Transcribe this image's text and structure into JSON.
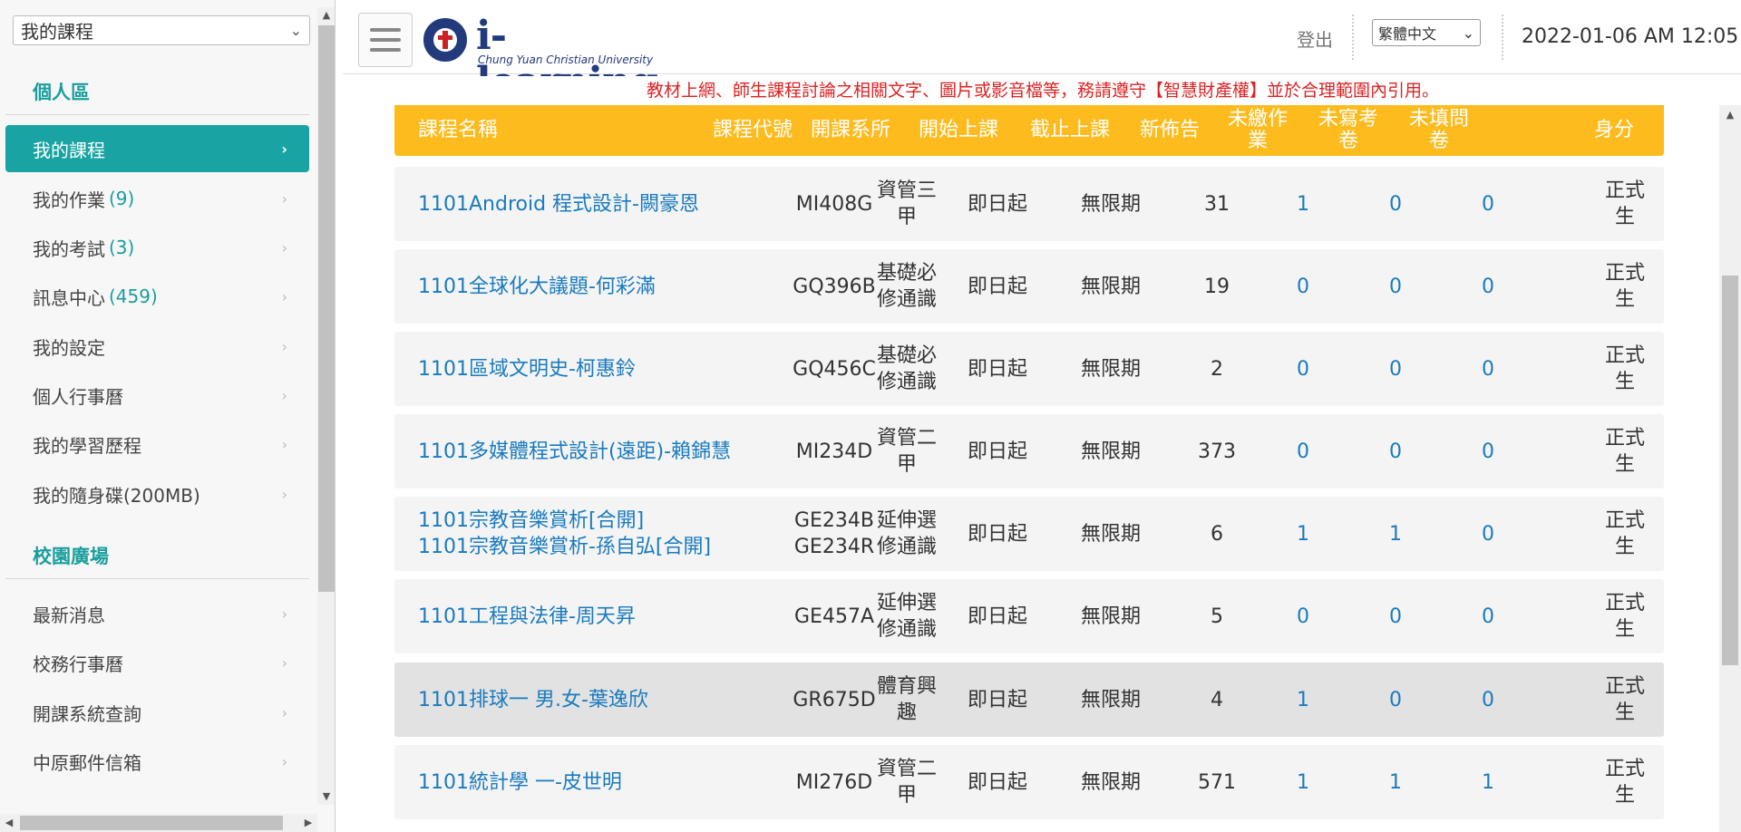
{
  "left_nav": {
    "select_value": "我的課程",
    "personal_section": "個人區",
    "campus_section": "校園廣場",
    "personal_items": [
      {
        "label": "我的課程",
        "count": ""
      },
      {
        "label": "我的作業",
        "count": "(9)"
      },
      {
        "label": "我的考試",
        "count": "(3)"
      },
      {
        "label": "訊息中心",
        "count": "(459)"
      },
      {
        "label": "我的設定",
        "count": ""
      },
      {
        "label": "個人行事曆",
        "count": ""
      },
      {
        "label": "我的學習歷程",
        "count": ""
      },
      {
        "label": "我的隨身碟(200MB)",
        "count": ""
      }
    ],
    "campus_items": [
      {
        "label": "最新消息"
      },
      {
        "label": "校務行事曆"
      },
      {
        "label": "開課系統查詢"
      },
      {
        "label": "中原郵件信箱"
      }
    ]
  },
  "header": {
    "brand": "i-learning",
    "brand_sub": "Chung Yuan Christian University",
    "logout": "登出",
    "language": "繁體中文",
    "datetime": "2022-01-06 AM 12:05"
  },
  "notice": "教材上網、師生課程討論之相關文字、圖片或影音檔等，務請遵守【智慧財產權】並於合理範圍內引用。",
  "table": {
    "headers": [
      "課程名稱",
      "課程代號",
      "開課系所",
      "開始上課",
      "截止上課",
      "新佈告",
      "未繳作業",
      "未寫考卷",
      "未填問卷",
      "身分"
    ],
    "rows": [
      {
        "name": "1101Android 程式設計-闕豪恩",
        "name2": "",
        "code": "MI408G",
        "code2": "",
        "dept": "資管三甲",
        "start": "即日起",
        "end": "無限期",
        "news": "31",
        "hw": "1",
        "exam": "0",
        "survey": "0",
        "role": "正式生"
      },
      {
        "name": "1101全球化大議題-何彩滿",
        "name2": "",
        "code": "GQ396B",
        "code2": "",
        "dept": "基礎必修通識",
        "start": "即日起",
        "end": "無限期",
        "news": "19",
        "hw": "0",
        "exam": "0",
        "survey": "0",
        "role": "正式生"
      },
      {
        "name": "1101區域文明史-柯惠鈴",
        "name2": "",
        "code": "GQ456C",
        "code2": "",
        "dept": "基礎必修通識",
        "start": "即日起",
        "end": "無限期",
        "news": "2",
        "hw": "0",
        "exam": "0",
        "survey": "0",
        "role": "正式生"
      },
      {
        "name": "1101多媒體程式設計(遠距)-賴錦慧",
        "name2": "",
        "code": "MI234D",
        "code2": "",
        "dept": "資管二甲",
        "start": "即日起",
        "end": "無限期",
        "news": "373",
        "hw": "0",
        "exam": "0",
        "survey": "0",
        "role": "正式生"
      },
      {
        "name": "1101宗教音樂賞析[合開]",
        "name2": "1101宗教音樂賞析-孫自弘[合開]",
        "code": "GE234B",
        "code2": "GE234R",
        "dept": "延伸選修通識",
        "start": "即日起",
        "end": "無限期",
        "news": "6",
        "hw": "1",
        "exam": "1",
        "survey": "0",
        "role": "正式生"
      },
      {
        "name": "1101工程與法律-周天昇",
        "name2": "",
        "code": "GE457A",
        "code2": "",
        "dept": "延伸選修通識",
        "start": "即日起",
        "end": "無限期",
        "news": "5",
        "hw": "0",
        "exam": "0",
        "survey": "0",
        "role": "正式生"
      },
      {
        "name": "1101排球一 男.女-葉逸欣",
        "name2": "",
        "code": "GR675D",
        "code2": "",
        "dept": "體育興趣",
        "start": "即日起",
        "end": "無限期",
        "news": "4",
        "hw": "1",
        "exam": "0",
        "survey": "0",
        "role": "正式生"
      },
      {
        "name": "1101統計學 一-皮世明",
        "name2": "",
        "code": "MI276D",
        "code2": "",
        "dept": "資管二甲",
        "start": "即日起",
        "end": "無限期",
        "news": "571",
        "hw": "1",
        "exam": "1",
        "survey": "1",
        "role": "正式生"
      }
    ]
  }
}
